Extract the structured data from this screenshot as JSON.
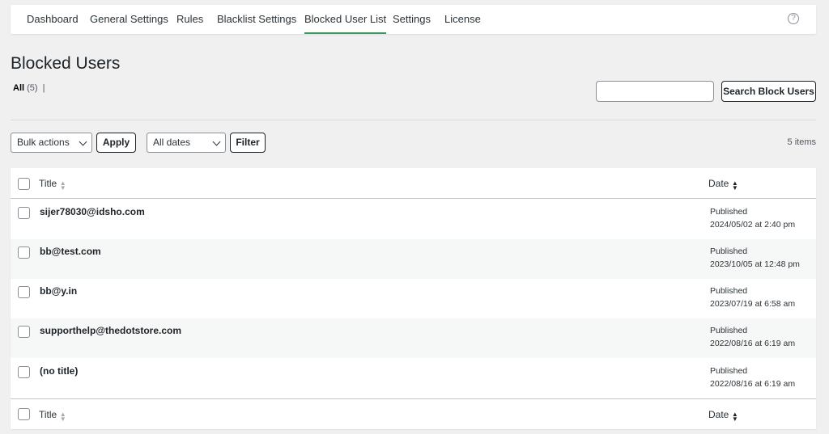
{
  "nav": {
    "tabs": [
      {
        "label": "Dashboard"
      },
      {
        "label": "General Settings"
      },
      {
        "label": "Rules"
      },
      {
        "label": "Blacklist Settings"
      },
      {
        "label": "Blocked User List",
        "active": true
      },
      {
        "label": "Settings"
      },
      {
        "label": "License"
      }
    ],
    "help_glyph": "?"
  },
  "page": {
    "title": "Blocked Users",
    "views": {
      "all_label": "All",
      "all_count": "(5)",
      "sep": "|"
    }
  },
  "search": {
    "placeholder": "",
    "button_label": "Search Block Users"
  },
  "toolbar": {
    "bulk_actions": "Bulk actions",
    "apply_label": "Apply",
    "dates": "All dates",
    "filter_label": "Filter",
    "items_count": "5 items"
  },
  "table": {
    "columns": {
      "title": "Title",
      "date": "Date"
    },
    "rows": [
      {
        "title": "sijer78030@idsho.com",
        "status": "Published",
        "date": "2024/05/02 at 2:40 pm"
      },
      {
        "title": "bb@test.com",
        "status": "Published",
        "date": "2023/10/05 at 12:48 pm"
      },
      {
        "title": "bb@y.in",
        "status": "Published",
        "date": "2023/07/19 at 6:58 am"
      },
      {
        "title": "supporthelp@thedotstore.com",
        "status": "Published",
        "date": "2022/08/16 at 6:19 am"
      },
      {
        "title": "(no title)",
        "status": "Published",
        "date": "2022/08/16 at 6:19 am"
      }
    ]
  },
  "colors": {
    "active_tab_underline": "#3c9a5e",
    "background": "#f0f0f1",
    "row_alt": "#f6f7f7"
  }
}
